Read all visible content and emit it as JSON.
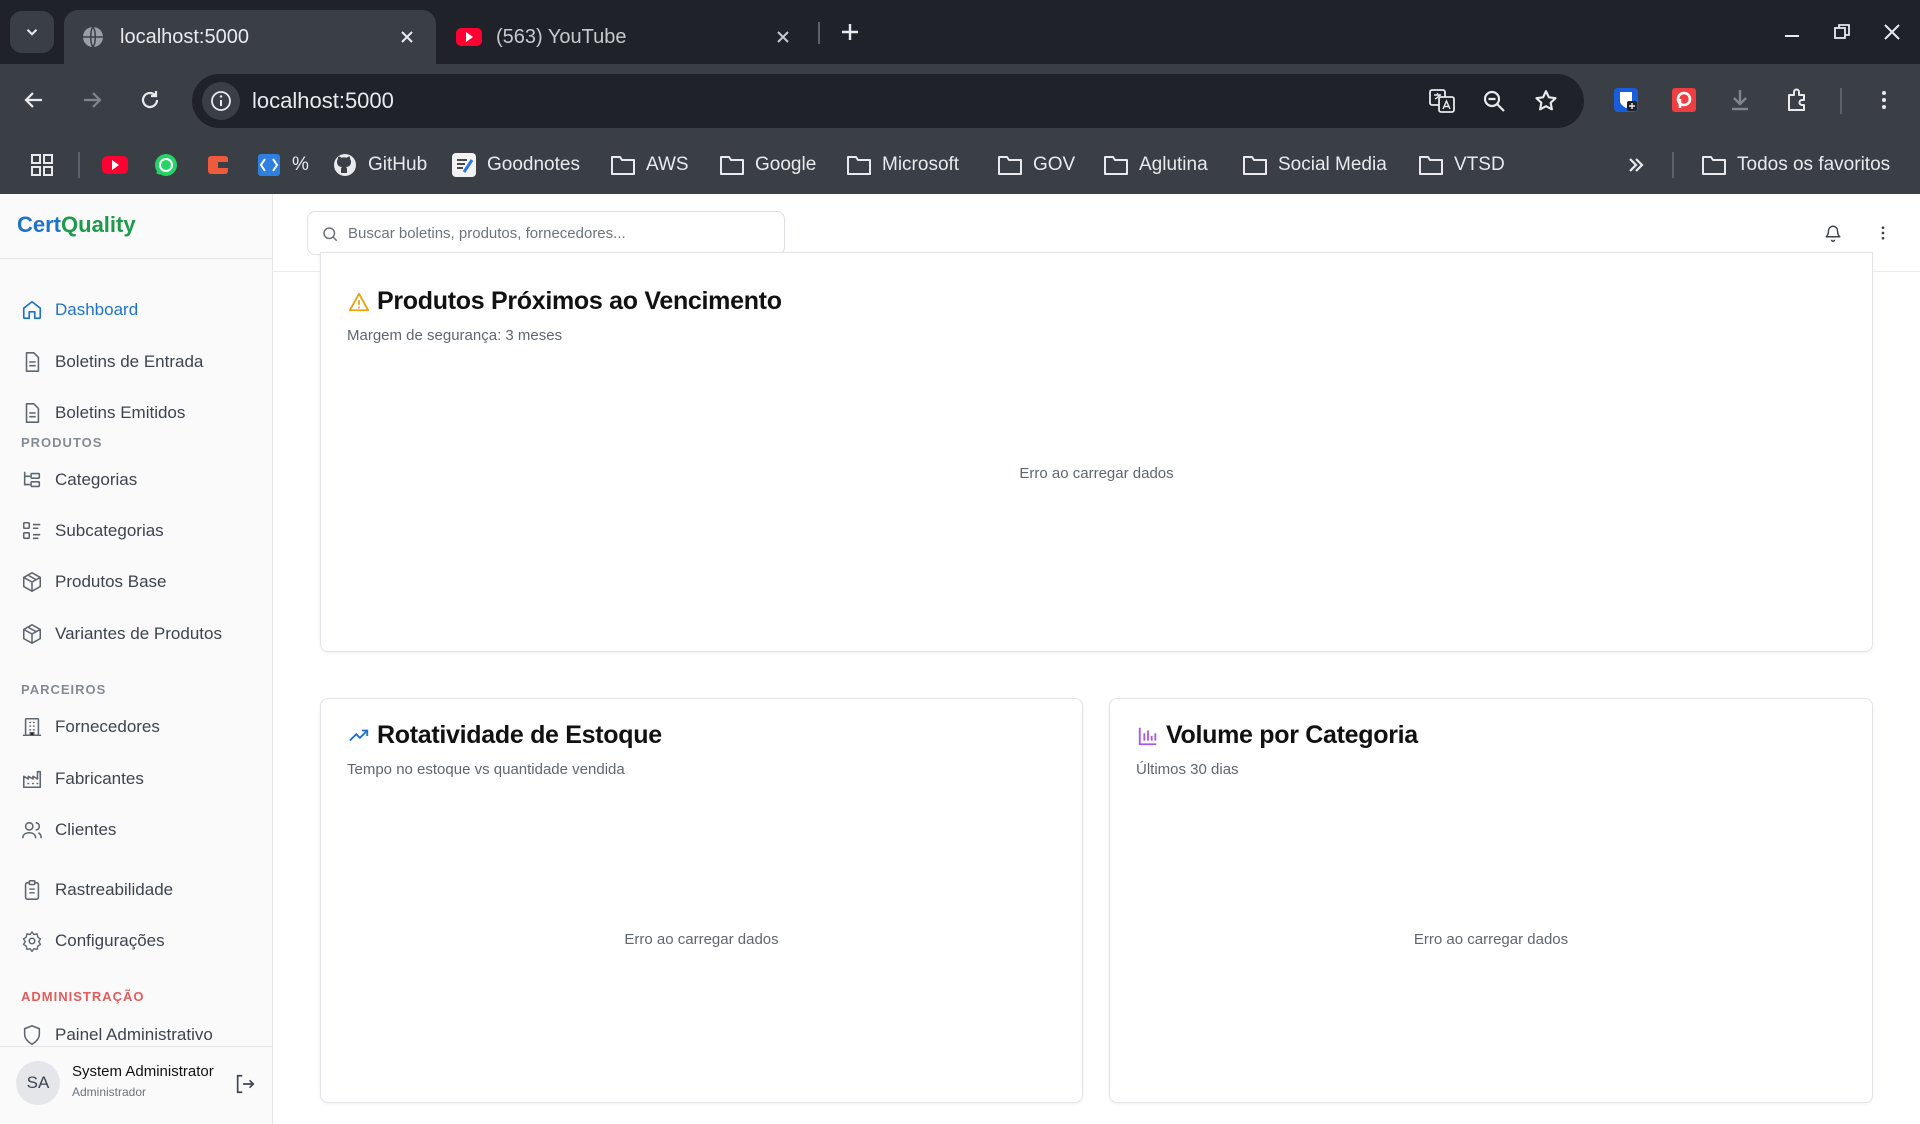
{
  "browser": {
    "tabs": [
      {
        "title": "localhost:5000",
        "active": true
      },
      {
        "title": "(563) YouTube",
        "active": false
      }
    ],
    "url": "localhost:5000",
    "bookmarks": {
      "percent": "%",
      "github": "GitHub",
      "goodnotes": "Goodnotes",
      "aws": "AWS",
      "google": "Google",
      "microsoft": "Microsoft",
      "gov": "GOV",
      "aglutina": "Aglutina",
      "social_media": "Social Media",
      "vtsd": "VTSD",
      "all": "Todos os favoritos"
    }
  },
  "app": {
    "brand_part1": "Cert",
    "brand_part2": "Quality",
    "nav": {
      "dashboard": "Dashboard",
      "boletins_entrada": "Boletins de Entrada",
      "boletins_emitidos": "Boletins Emitidos",
      "section_produtos": "PRODUTOS",
      "categorias": "Categorias",
      "subcategorias": "Subcategorias",
      "produtos_base": "Produtos Base",
      "variantes": "Variantes de Produtos",
      "section_parceiros": "PARCEIROS",
      "fornecedores": "Fornecedores",
      "fabricantes": "Fabricantes",
      "clientes": "Clientes",
      "rastreabilidade": "Rastreabilidade",
      "configuracoes": "Configurações",
      "section_admin": "ADMINISTRAÇÃO",
      "painel_admin": "Painel Administrativo"
    },
    "user": {
      "initials": "SA",
      "name": "System Administrator",
      "role": "Administrador"
    },
    "search_placeholder": "Buscar boletins, produtos, fornecedores..."
  },
  "cards": {
    "vencimento": {
      "title": "Produtos Próximos ao Vencimento",
      "subtitle": "Margem de segurança: 3 meses",
      "message": "Erro ao carregar dados"
    },
    "rotatividade": {
      "title": "Rotatividade de Estoque",
      "subtitle": "Tempo no estoque vs quantidade vendida",
      "message": "Erro ao carregar dados"
    },
    "volume": {
      "title": "Volume por Categoria",
      "subtitle": "Últimos 30 dias",
      "message": "Erro ao carregar dados"
    }
  },
  "colors": {
    "brand_blue": "#1e73c8",
    "brand_green": "#1e9a4c",
    "warning": "#e8a317",
    "trend_blue": "#1e73c8",
    "chart_purple": "#a855f7",
    "admin_red": "#e35b5b"
  }
}
